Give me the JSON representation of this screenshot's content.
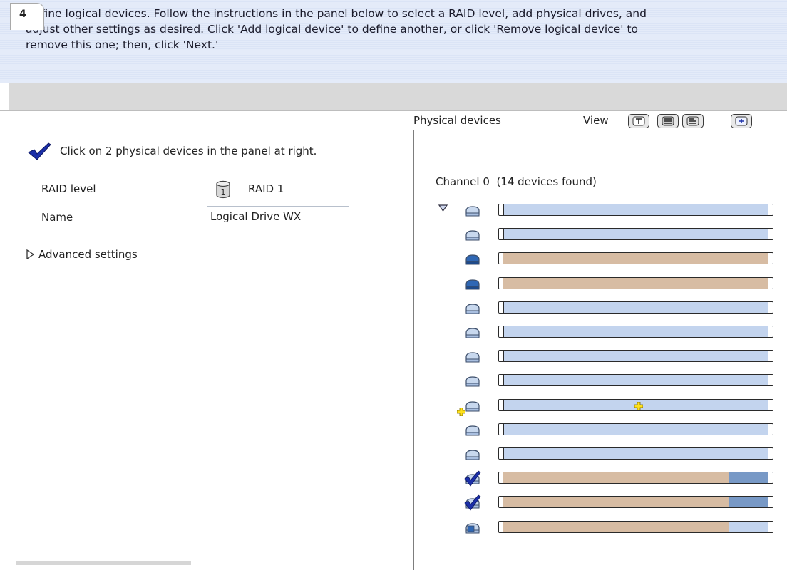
{
  "instructions": {
    "line1": "Define logical devices.  Follow the instructions in the panel below to select a RAID level, add physical drives, and",
    "line2": "adjust other settings as desired.  Click 'Add logical device' to define another, or click 'Remove logical device' to",
    "line3": "remove this one; then, click 'Next.'"
  },
  "tabs": [
    {
      "label": "4"
    }
  ],
  "left": {
    "requirement": "Click on 2 physical devices in the panel at right.",
    "raid_label": "RAID level",
    "raid_value": "RAID 1",
    "raid_icon_digit": "1",
    "name_label": "Name",
    "name_value": "Logical Drive WX",
    "advanced_label": "Advanced settings"
  },
  "right": {
    "title": "Physical devices",
    "view_label": "View",
    "view_buttons": [
      {
        "icon": "text-view-icon"
      },
      {
        "icon": "full-size-view-icon"
      },
      {
        "icon": "relative-size-view-icon"
      },
      {
        "icon": "expand-all-icon"
      }
    ],
    "channel_label": "Channel 0",
    "channel_count": "(14 devices found)"
  },
  "colors": {
    "free_fill": "#c3d4ee",
    "used_fill": "#d7bca3",
    "selected_fill": "#7899c6",
    "check_blue": "#1b2fa8",
    "drive_icon_light": "#c8d8ee",
    "drive_icon_dark": "#2f67b4"
  },
  "devices": [
    {
      "icon": "drive-icon",
      "state": "available",
      "used": 0,
      "selected": 0
    },
    {
      "icon": "drive-icon",
      "state": "available",
      "used": 0,
      "selected": 0
    },
    {
      "icon": "drive-in-use-icon",
      "state": "in-use",
      "used": 1,
      "selected": 0
    },
    {
      "icon": "drive-in-use-icon",
      "state": "in-use",
      "used": 1,
      "selected": 0
    },
    {
      "icon": "drive-icon",
      "state": "available",
      "used": 0,
      "selected": 0
    },
    {
      "icon": "drive-icon",
      "state": "available",
      "used": 0,
      "selected": 0
    },
    {
      "icon": "drive-icon",
      "state": "available",
      "used": 0,
      "selected": 0
    },
    {
      "icon": "drive-icon",
      "state": "available",
      "used": 0,
      "selected": 0
    },
    {
      "icon": "drive-add-icon",
      "state": "hover",
      "used": 0,
      "selected": 0
    },
    {
      "icon": "drive-icon",
      "state": "available",
      "used": 0,
      "selected": 0
    },
    {
      "icon": "drive-icon",
      "state": "available",
      "used": 0,
      "selected": 0
    },
    {
      "icon": "drive-selected-icon",
      "state": "selected",
      "used": 0.85,
      "selected": 0.15
    },
    {
      "icon": "drive-selected-icon",
      "state": "selected",
      "used": 0.85,
      "selected": 0.15
    },
    {
      "icon": "drive-partial-icon",
      "state": "partial",
      "used": 0.85,
      "selected": 0
    }
  ]
}
